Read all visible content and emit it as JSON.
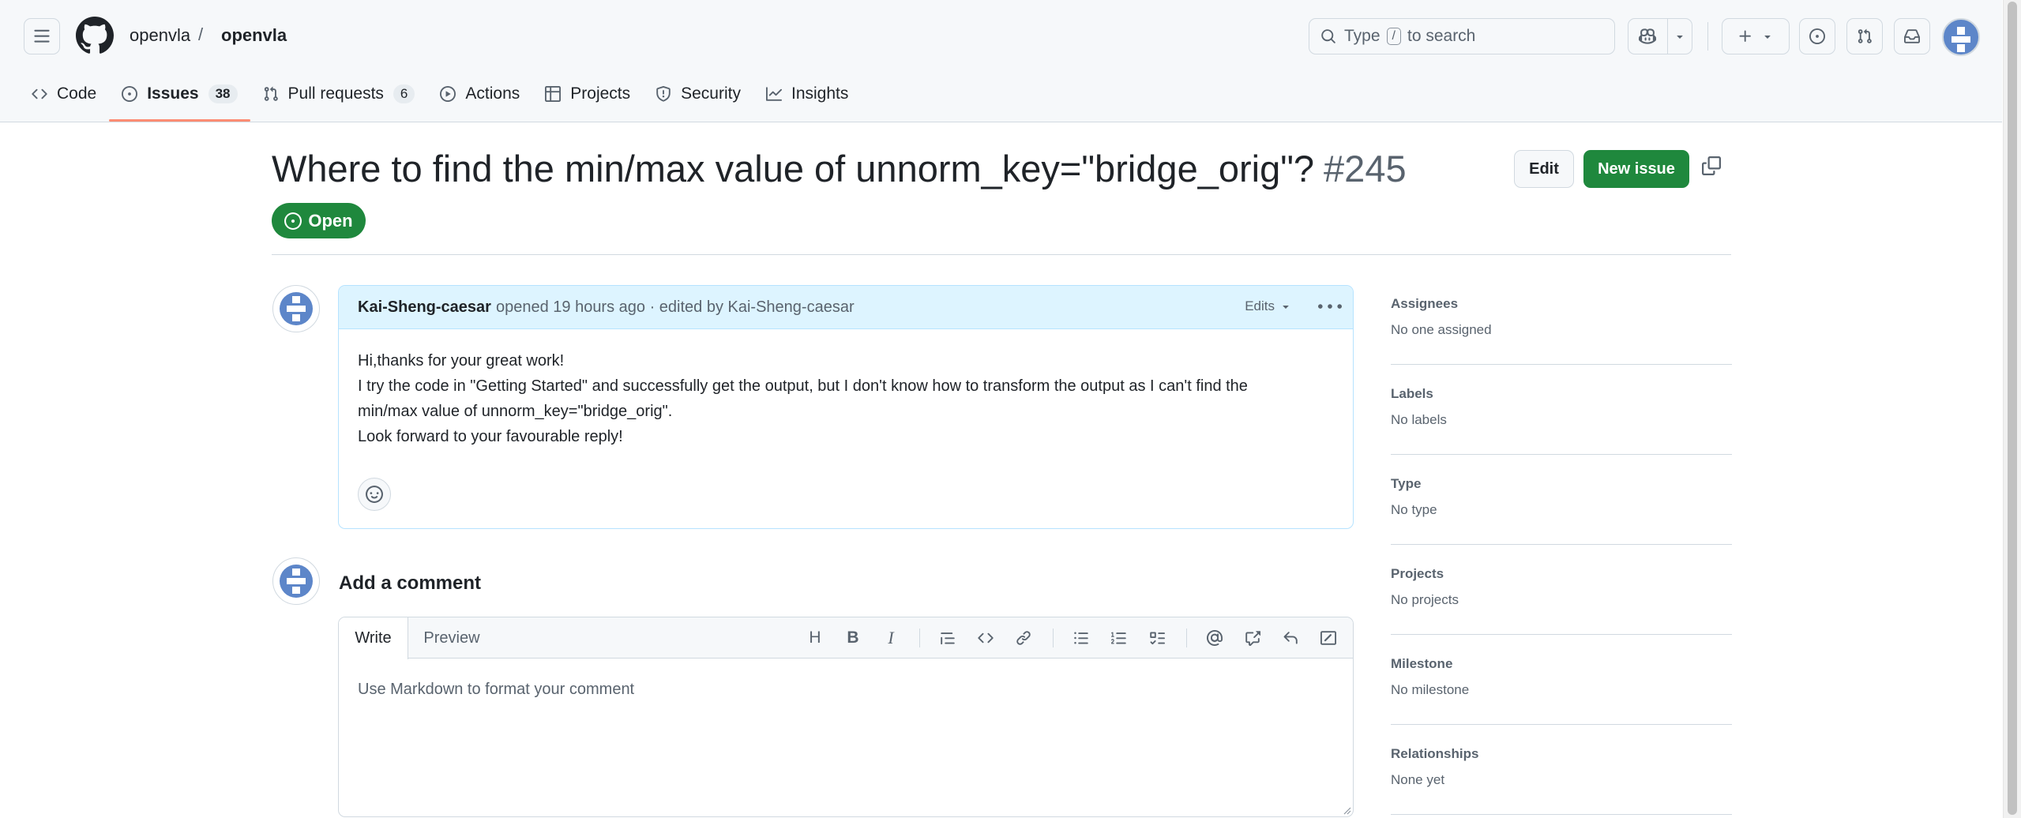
{
  "header": {
    "owner": "openvla",
    "separator": "/",
    "repo": "openvla",
    "search_prefix": "Type",
    "search_key": "/",
    "search_suffix": "to search"
  },
  "tabs": [
    {
      "label": "Code",
      "icon": "code-icon"
    },
    {
      "label": "Issues",
      "icon": "issue-opened-icon",
      "count": "38"
    },
    {
      "label": "Pull requests",
      "icon": "git-pull-request-icon",
      "count": "6"
    },
    {
      "label": "Actions",
      "icon": "play-icon"
    },
    {
      "label": "Projects",
      "icon": "table-icon"
    },
    {
      "label": "Security",
      "icon": "shield-icon"
    },
    {
      "label": "Insights",
      "icon": "graph-icon"
    }
  ],
  "issue": {
    "title": "Where to find the min/max value of unnorm_key=\"bridge_orig\"?",
    "number": "#245",
    "state": "Open",
    "edit_label": "Edit",
    "new_issue_label": "New issue"
  },
  "comment": {
    "author": "Kai-Sheng-caesar",
    "meta": "opened 19 hours ago · edited by Kai-Sheng-caesar",
    "edits_label": "Edits",
    "body": [
      "Hi,thanks for your great work!",
      "I try the code in \"Getting Started\" and successfully get the output, but I don't know how to transform the output as I can't find the",
      "min/max value of unnorm_key=\"bridge_orig\".",
      "Look forward to your favourable reply!"
    ]
  },
  "add_comment": {
    "title": "Add a comment",
    "write_tab": "Write",
    "preview_tab": "Preview",
    "heading_glyph": "H",
    "bold_glyph": "B",
    "italic_glyph": "I",
    "placeholder": "Use Markdown to format your comment"
  },
  "sidebar": [
    {
      "label": "Assignees",
      "value": "No one assigned"
    },
    {
      "label": "Labels",
      "value": "No labels"
    },
    {
      "label": "Type",
      "value": "No type"
    },
    {
      "label": "Projects",
      "value": "No projects"
    },
    {
      "label": "Milestone",
      "value": "No milestone"
    },
    {
      "label": "Relationships",
      "value": "None yet"
    }
  ],
  "colors": {
    "accent_green": "#1f883d",
    "tab_underline": "#fd8c73",
    "comment_header_bg": "#ddf4ff",
    "avatar_blue": "#5d86c9"
  }
}
